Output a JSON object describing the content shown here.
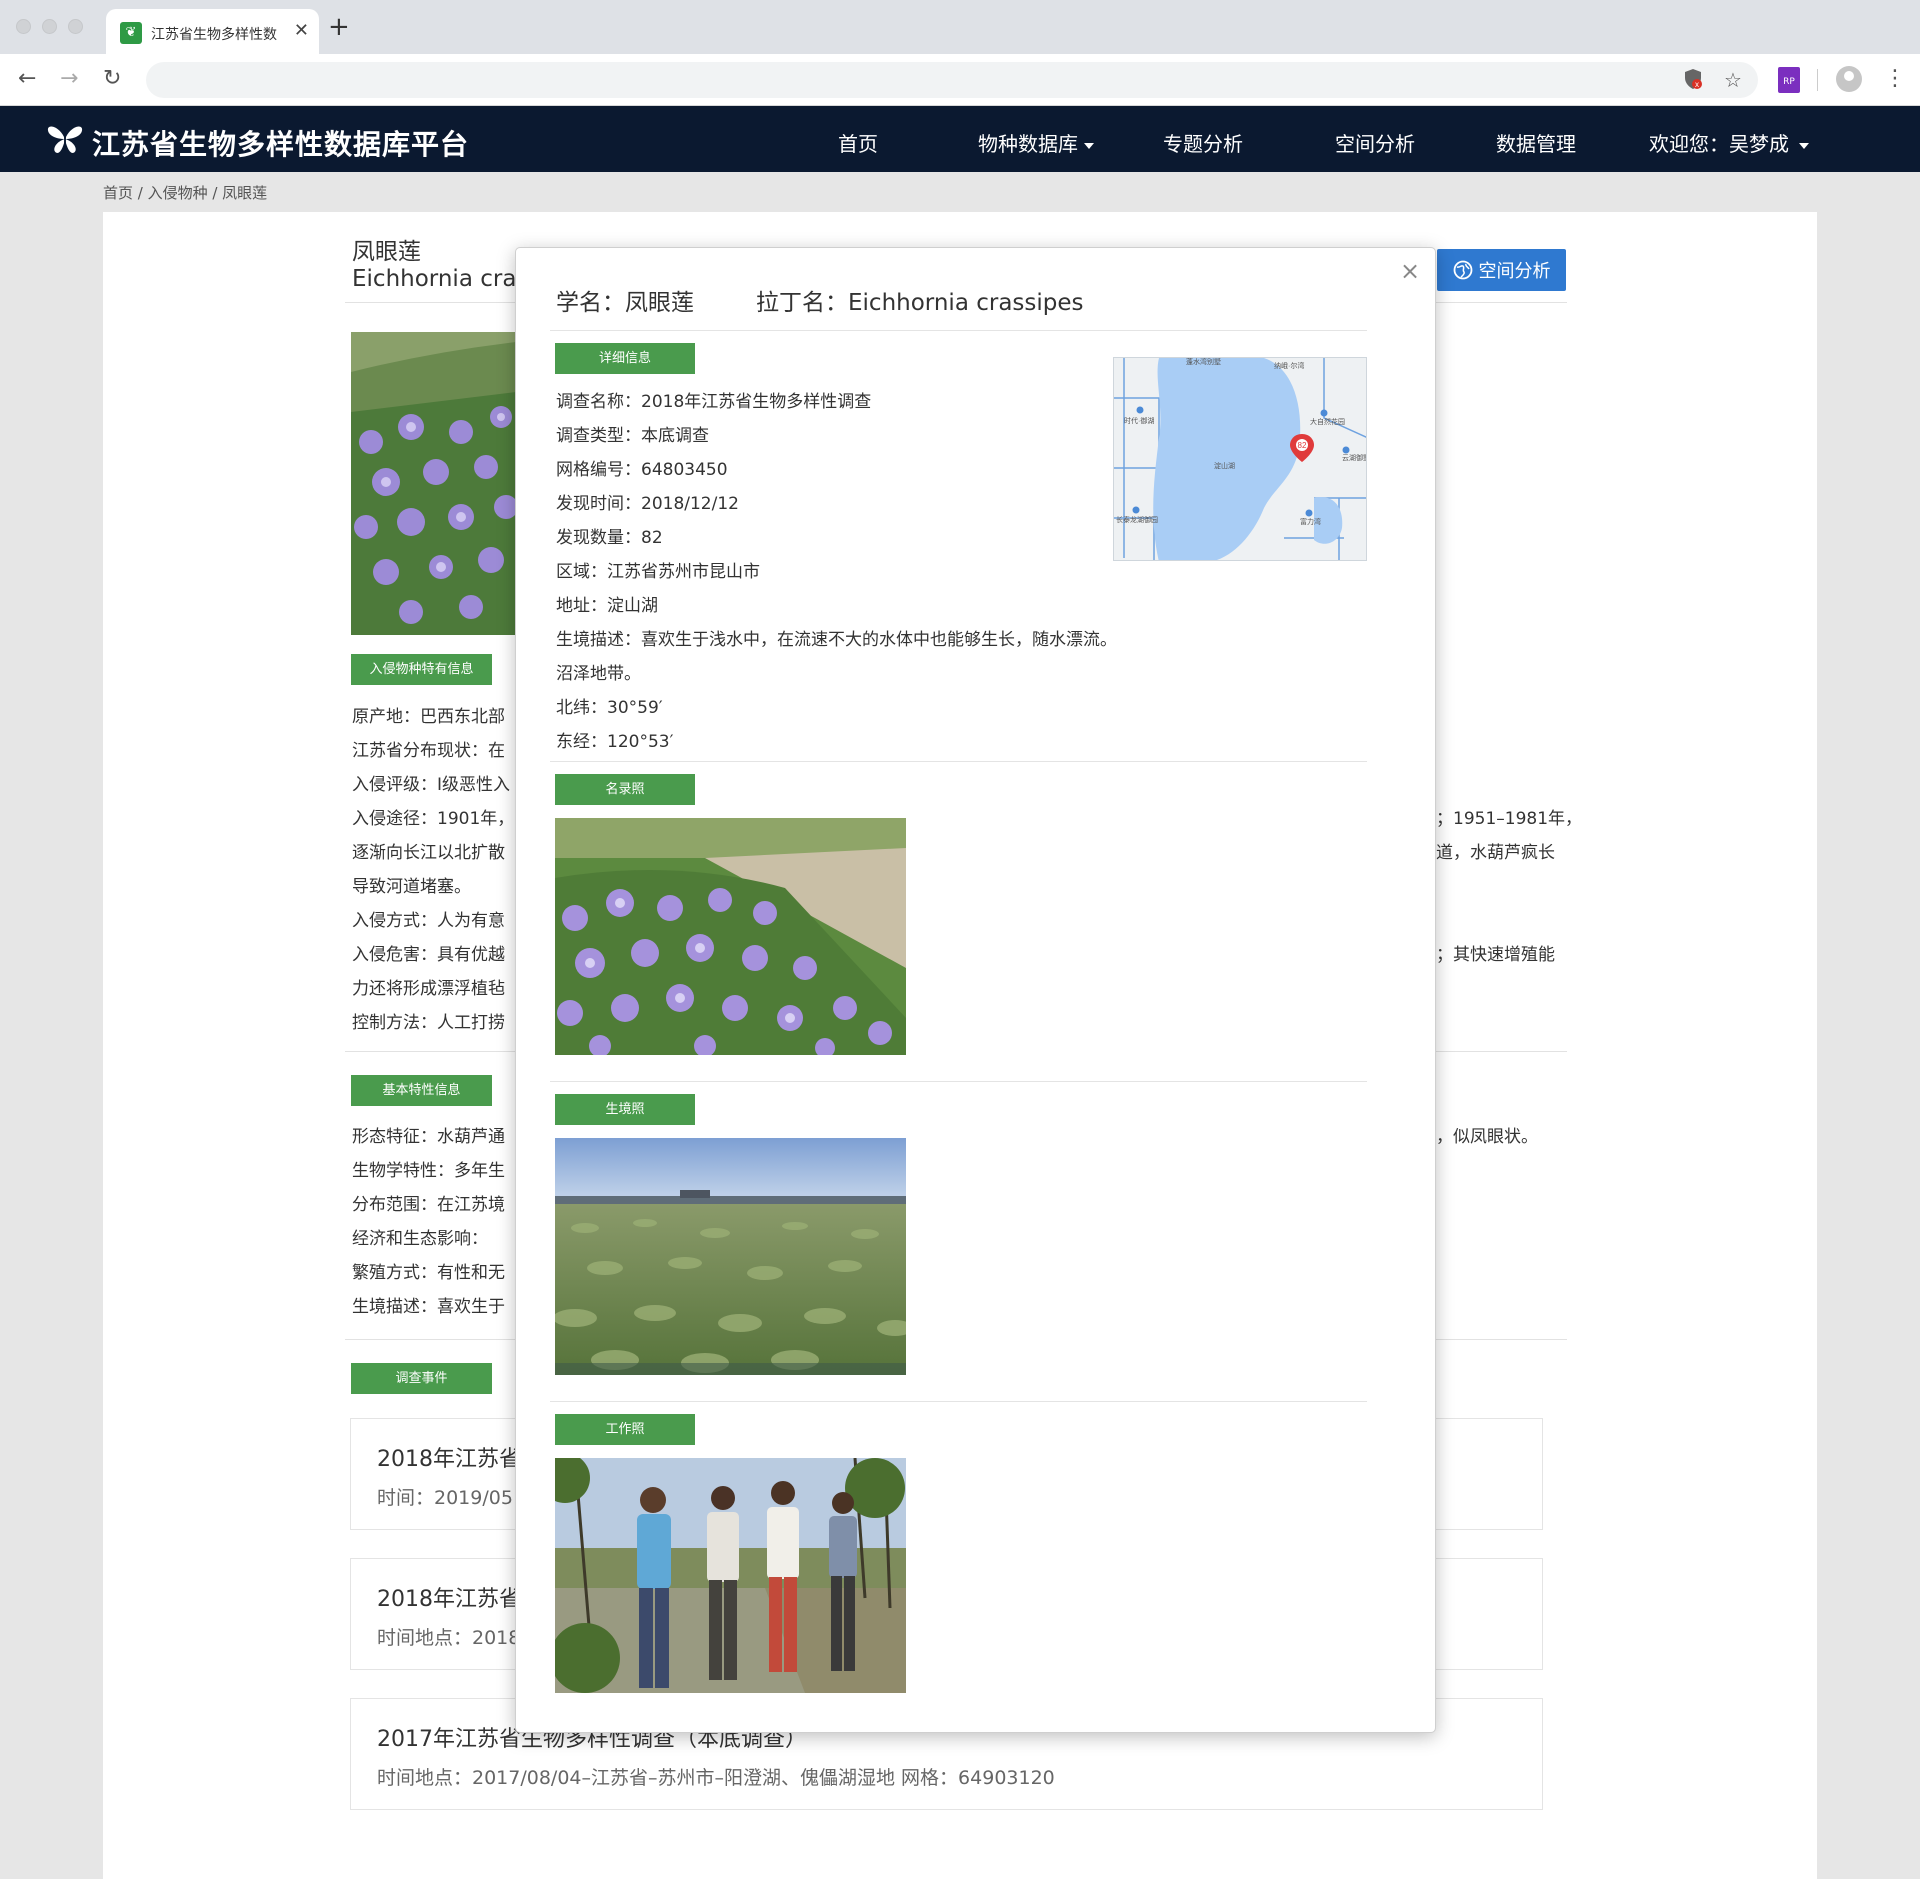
{
  "browser": {
    "tab_title": "江苏省生物多样性数",
    "tab_close": "✕",
    "new_tab": "+",
    "ext_label": "RP"
  },
  "site": {
    "logo_text": "江苏省生物多样性数据库平台",
    "nav": {
      "home": "首页",
      "species_db": "物种数据库",
      "topic": "专题分析",
      "spatial": "空间分析",
      "data_mgmt": "数据管理",
      "welcome": "欢迎您：吴梦成"
    }
  },
  "breadcrumb": "首页 / 入侵物种 / 凤眼莲",
  "species": {
    "name": "凤眼莲",
    "latin": "Eichhornia cras",
    "spatial_button": "空间分析"
  },
  "invasive": {
    "tag": "入侵物种特有信息",
    "lines": [
      "原产地：巴西东北部",
      "江苏省分布现状：在",
      "入侵评级：I级恶性入",
      "入侵途径：1901年，",
      "逐渐向长江以北扩散",
      "导致河道堵塞。",
      "入侵方式：人为有意",
      "入侵危害：具有优越",
      "力还将形成漂浮植毡",
      "控制方法：人工打捞"
    ],
    "right_fragments": [
      "；1951–1981年，",
      "道，水葫芦疯长",
      "；其快速增殖能"
    ]
  },
  "basic": {
    "tag": "基本特性信息",
    "lines": [
      "形态特征：水葫芦通",
      "生物学特性：多年生",
      "分布范围：在江苏境",
      "经济和生态影响：",
      "繁殖方式：有性和无",
      "生境描述：喜欢生于"
    ],
    "right_fragment": "，似凤眼状。"
  },
  "events": {
    "tag": "调查事件",
    "items": [
      {
        "title": "2018年江苏省",
        "meta": "时间：2019/05"
      },
      {
        "title": "2018年江苏省",
        "meta": "时间地点：2018"
      },
      {
        "title": "2017年江苏省生物多样性调查（本底调查）",
        "meta": "时间地点：2017/08/04–江苏省–苏州市–阳澄湖、傀儡湖湿地   网格：64903120"
      }
    ]
  },
  "modal": {
    "close": "×",
    "title": "学名：凤眼莲",
    "latin": "拉丁名：Eichhornia crassipes",
    "detail_tag": "详细信息",
    "details": [
      "调查名称：2018年江苏省生物多样性调查",
      "调查类型：本底调查",
      "网格编号：64803450",
      "发现时间：2018/12/12",
      "发现数量：82",
      "区域：江苏省苏州市昆山市",
      "地址：淀山湖",
      "生境描述：喜欢生于浅水中，在流速不大的水体中也能够生长，随水漂流。",
      "沼泽地带。",
      "北纬：30°59′",
      "东经：120°53′"
    ],
    "map_marker": "82",
    "map_labels": [
      "蓬水湾别墅",
      "纳峨·尔湾",
      "时代·御湖",
      "大自然花园",
      "云湖御墅",
      "长泰龙湖御园",
      "富力湾",
      "淀山湖"
    ],
    "photo_tags": [
      "名录照",
      "生境照",
      "工作照"
    ]
  },
  "colors": {
    "navbar": "#0b1930",
    "tag_green": "#4a9b4d",
    "button_blue": "#2f79d0",
    "water": "#a9cdf5"
  }
}
